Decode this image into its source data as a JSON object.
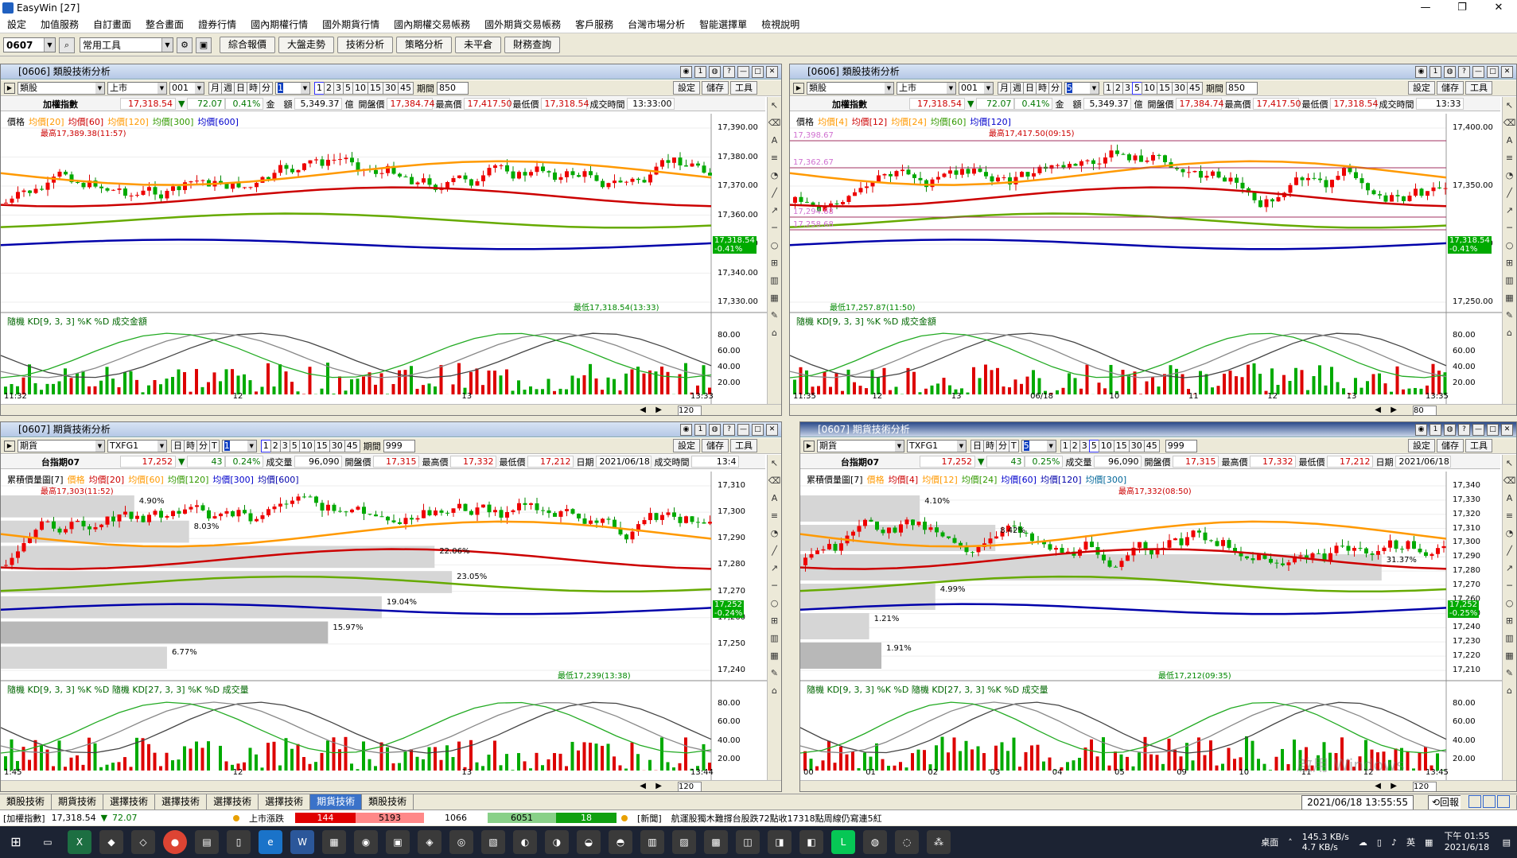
{
  "window": {
    "title": "EasyWin  [27]",
    "min": "—",
    "restore": "❐",
    "close": "✕"
  },
  "menu": [
    "設定",
    "加值服務",
    "自訂畫面",
    "整合畫面",
    "證券行情",
    "國內期權行情",
    "國外期貨行情",
    "國內期權交易帳務",
    "國外期貨交易帳務",
    "客戶服務",
    "台灣市場分析",
    "智能選擇單",
    "檢視說明"
  ],
  "toolbar": {
    "code": "0607",
    "tools": "常用工具",
    "buttons": [
      "綜合報價",
      "大盤走勢",
      "技術分析",
      "策略分析",
      "未平倉",
      "財務查詢"
    ]
  },
  "panels": [
    {
      "title": "[0606] 類股技術分析",
      "type_sel": "類股",
      "market": "上市",
      "code": "001",
      "periods": [
        "月",
        "週",
        "日",
        "時",
        "分"
      ],
      "active_p": "1",
      "nums": [
        "1",
        "2",
        "3",
        "5",
        "10",
        "15",
        "30",
        "45"
      ],
      "period_label": "期間",
      "period_val": "850",
      "btns": [
        "設定",
        "儲存",
        "工具"
      ],
      "quote": {
        "name": "加權指數",
        "price": "17,318.54",
        "chg": "72.07",
        "pct": "0.41%",
        "amt_label": "金　額",
        "amt": "5,349.37",
        "amt_unit": "億",
        "open_l": "開盤價",
        "open": "17,384.74",
        "high_l": "最高價",
        "high": "17,417.50",
        "low_l": "最低價",
        "low": "17,318.54",
        "time_l": "成交時間",
        "time": "13:33:00"
      },
      "legend": [
        "價格",
        "均價[20]",
        "均價[60]",
        "均價[120]",
        "均價[300]",
        "均價[600]"
      ],
      "high_ann": "最高17,389.38(11:57)",
      "low_ann": "最低17,318.54(13:33)",
      "yticks": [
        "17,390.00",
        "17,380.00",
        "17,370.00",
        "17,360.00",
        "17,350.00",
        "17,340.00",
        "17,330.00"
      ],
      "price_tag": "17,318.54",
      "pct_tag": "-0.41%",
      "kd_legend": "隨機 KD[9, 3, 3] %K %D 成交金額",
      "kd_ticks": [
        "80.00",
        "60.00",
        "40.00",
        "20.00"
      ],
      "xticks": [
        "11:32",
        "12",
        "13",
        "13:33"
      ],
      "zoom": "120"
    },
    {
      "title": "[0606] 類股技術分析",
      "type_sel": "類股",
      "market": "上市",
      "code": "001",
      "periods": [
        "月",
        "週",
        "日",
        "時",
        "分"
      ],
      "active_p": "5",
      "nums": [
        "1",
        "2",
        "3",
        "5",
        "10",
        "15",
        "30",
        "45"
      ],
      "period_label": "期間",
      "period_val": "850",
      "btns": [
        "設定",
        "儲存",
        "工具"
      ],
      "quote": {
        "name": "加權指數",
        "price": "17,318.54",
        "chg": "72.07",
        "pct": "0.41%",
        "amt_label": "金　額",
        "amt": "5,349.37",
        "amt_unit": "億",
        "open_l": "開盤價",
        "open": "17,384.74",
        "high_l": "最高價",
        "high": "17,417.50",
        "low_l": "最低價",
        "low": "17,318.54",
        "time_l": "成交時間",
        "time": "13:33"
      },
      "legend": [
        "價格",
        "均價[4]",
        "均價[12]",
        "均價[24]",
        "均價[60]",
        "均價[120]"
      ],
      "high_ann": "最高17,417.50(09:15)",
      "low_ann": "最低17,257.87(11:50)",
      "yticks": [
        "17,400.00",
        "17,350.00",
        "17,300.00",
        "17,250.00"
      ],
      "levels": [
        "17,398.67",
        "17,362.67",
        "17,294.68",
        "17,258.68"
      ],
      "price_tag": "17,318.54",
      "pct_tag": "-0.41%",
      "kd_legend": "隨機 KD[9, 3, 3] %K %D 成交金額",
      "kd_ticks": [
        "80.00",
        "60.00",
        "40.00",
        "20.00"
      ],
      "xticks": [
        "11:35",
        "12",
        "13",
        "06/18",
        "10",
        "11",
        "12",
        "13",
        "13:35"
      ],
      "zoom": "80"
    },
    {
      "title": "[0607] 期貨技術分析",
      "type_sel": "期貨",
      "market": "TXFG1",
      "periods": [
        "日",
        "時",
        "分",
        "T"
      ],
      "active_p": "1",
      "nums": [
        "1",
        "2",
        "3",
        "5",
        "10",
        "15",
        "30",
        "45"
      ],
      "period_label": "期間",
      "period_val": "999",
      "btns": [
        "設定",
        "儲存",
        "工具"
      ],
      "quote": {
        "name": "台指期07",
        "price": "17,252",
        "chg": "43",
        "pct": "0.24%",
        "vol_l": "成交量",
        "vol": "96,090",
        "open_l": "開盤價",
        "open": "17,315",
        "high_l": "最高價",
        "high": "17,332",
        "low_l": "最低價",
        "low": "17,212",
        "date_l": "日期",
        "date": "2021/06/18",
        "time_l": "成交時間",
        "time": "13:4"
      },
      "legend": [
        "累積價量圖[7]",
        "價格",
        "均價[20]",
        "均價[60]",
        "均價[120]",
        "均價[300]",
        "均價[600]"
      ],
      "high_ann": "最高17,303(11:52)",
      "low_ann": "最低17,239(13:38)",
      "vp": [
        "4.90%",
        "8.03%",
        "22.06%",
        "23.05%",
        "19.04%",
        "15.97%",
        "6.77%"
      ],
      "yticks": [
        "17,310",
        "17,300",
        "17,290",
        "17,280",
        "17,270",
        "17,260",
        "17,250",
        "17,240"
      ],
      "price_tag": "17,252",
      "pct_tag": "-0.24%",
      "kd_legend": "隨機 KD[9, 3, 3] %K %D 隨機 KD[27, 3, 3] %K %D 成交量",
      "kd_ticks": [
        "80.00",
        "60.00",
        "40.00",
        "20.00"
      ],
      "xticks": [
        "1:45",
        "12",
        "13",
        "13:44"
      ],
      "zoom": "120"
    },
    {
      "title": "[0607] 期貨技術分析",
      "type_sel": "期貨",
      "market": "TXFG1",
      "periods": [
        "日",
        "時",
        "分",
        "T"
      ],
      "active_p": "5",
      "nums": [
        "1",
        "2",
        "3",
        "5",
        "10",
        "15",
        "30",
        "45"
      ],
      "period_label": "",
      "period_val": "999",
      "btns": [
        "設定",
        "儲存",
        "工具"
      ],
      "quote": {
        "name": "台指期07",
        "price": "17,252",
        "chg": "43",
        "pct": "0.25%",
        "vol_l": "成交量",
        "vol": "96,090",
        "open_l": "開盤價",
        "open": "17,315",
        "high_l": "最高價",
        "high": "17,332",
        "low_l": "最低價",
        "low": "17,212",
        "date_l": "日期",
        "date": "2021/06/18"
      },
      "legend": [
        "累積價量圖[7]",
        "價格",
        "均價[4]",
        "均價[12]",
        "均價[24]",
        "均價[60]",
        "均價[120]",
        "均價[300]"
      ],
      "high_ann": "最高17,332(08:50)",
      "low_ann": "最低17,212(09:35)",
      "vp": [
        "4.10%",
        "8.42%",
        "31.37%",
        "4.99%",
        "1.21%",
        "1.91%"
      ],
      "yticks": [
        "17,340",
        "17,330",
        "17,320",
        "17,310",
        "17,300",
        "17,290",
        "17,280",
        "17,270",
        "17,260",
        "17,250",
        "17,240",
        "17,230",
        "17,220",
        "17,210"
      ],
      "price_tag": "17,252",
      "pct_tag": "-0.25%",
      "kd_legend": "隨機 KD[9, 3, 3] %K %D 隨機 KD[27, 3, 3] %K %D 成交量",
      "kd_ticks": [
        "80.00",
        "60.00",
        "40.00",
        "20.00"
      ],
      "xticks": [
        "00",
        "01",
        "02",
        "03",
        "04",
        "05",
        "09",
        "10",
        "11",
        "12",
        "13:45"
      ],
      "zoom": "120"
    }
  ],
  "tabs": [
    "類股技術",
    "期貨技術",
    "選擇技術",
    "選擇技術",
    "選擇技術",
    "選擇技術",
    "期貨技術",
    "類股技術"
  ],
  "active_tab": 6,
  "datetime": "2021/06/18 13:55:55",
  "back": "回報",
  "status": {
    "idx_name": "[加權指數]",
    "idx_price": "17,318.54",
    "idx_chg": "72.07",
    "mkt": "上市漲跌",
    "b1": "144",
    "b2": "5193",
    "b3": "1066",
    "b4": "6051",
    "b5": "18",
    "news_l": "[新聞]",
    "news": "航運股獨木難撐台股跌72點收17318點周線仍寫連5紅"
  },
  "tray": {
    "lang": "英",
    "net_up": "145.3 KB/s",
    "net_dn": "4.7 KB/s",
    "desk": "桌面",
    "time": "下午 01:55",
    "date": "2021/6/18",
    "watermark": "啟用 Windows"
  },
  "chart_data": [
    {
      "type": "candlestick",
      "title": "加權指數 1分",
      "ylim": [
        17325,
        17395
      ],
      "open": 17384.74,
      "high": 17389.38,
      "low": 17318.54,
      "close": 17318.54
    },
    {
      "type": "candlestick",
      "title": "加權指數 5分",
      "ylim": [
        17245,
        17420
      ],
      "high": 17417.5,
      "low": 17257.87,
      "close": 17318.54
    },
    {
      "type": "candlestick",
      "title": "台指期07 1分",
      "ylim": [
        17235,
        17312
      ],
      "high": 17303,
      "low": 17239,
      "close": 17252
    },
    {
      "type": "candlestick",
      "title": "台指期07 5分",
      "ylim": [
        17205,
        17345
      ],
      "high": 17332,
      "low": 17212,
      "close": 17252
    }
  ]
}
